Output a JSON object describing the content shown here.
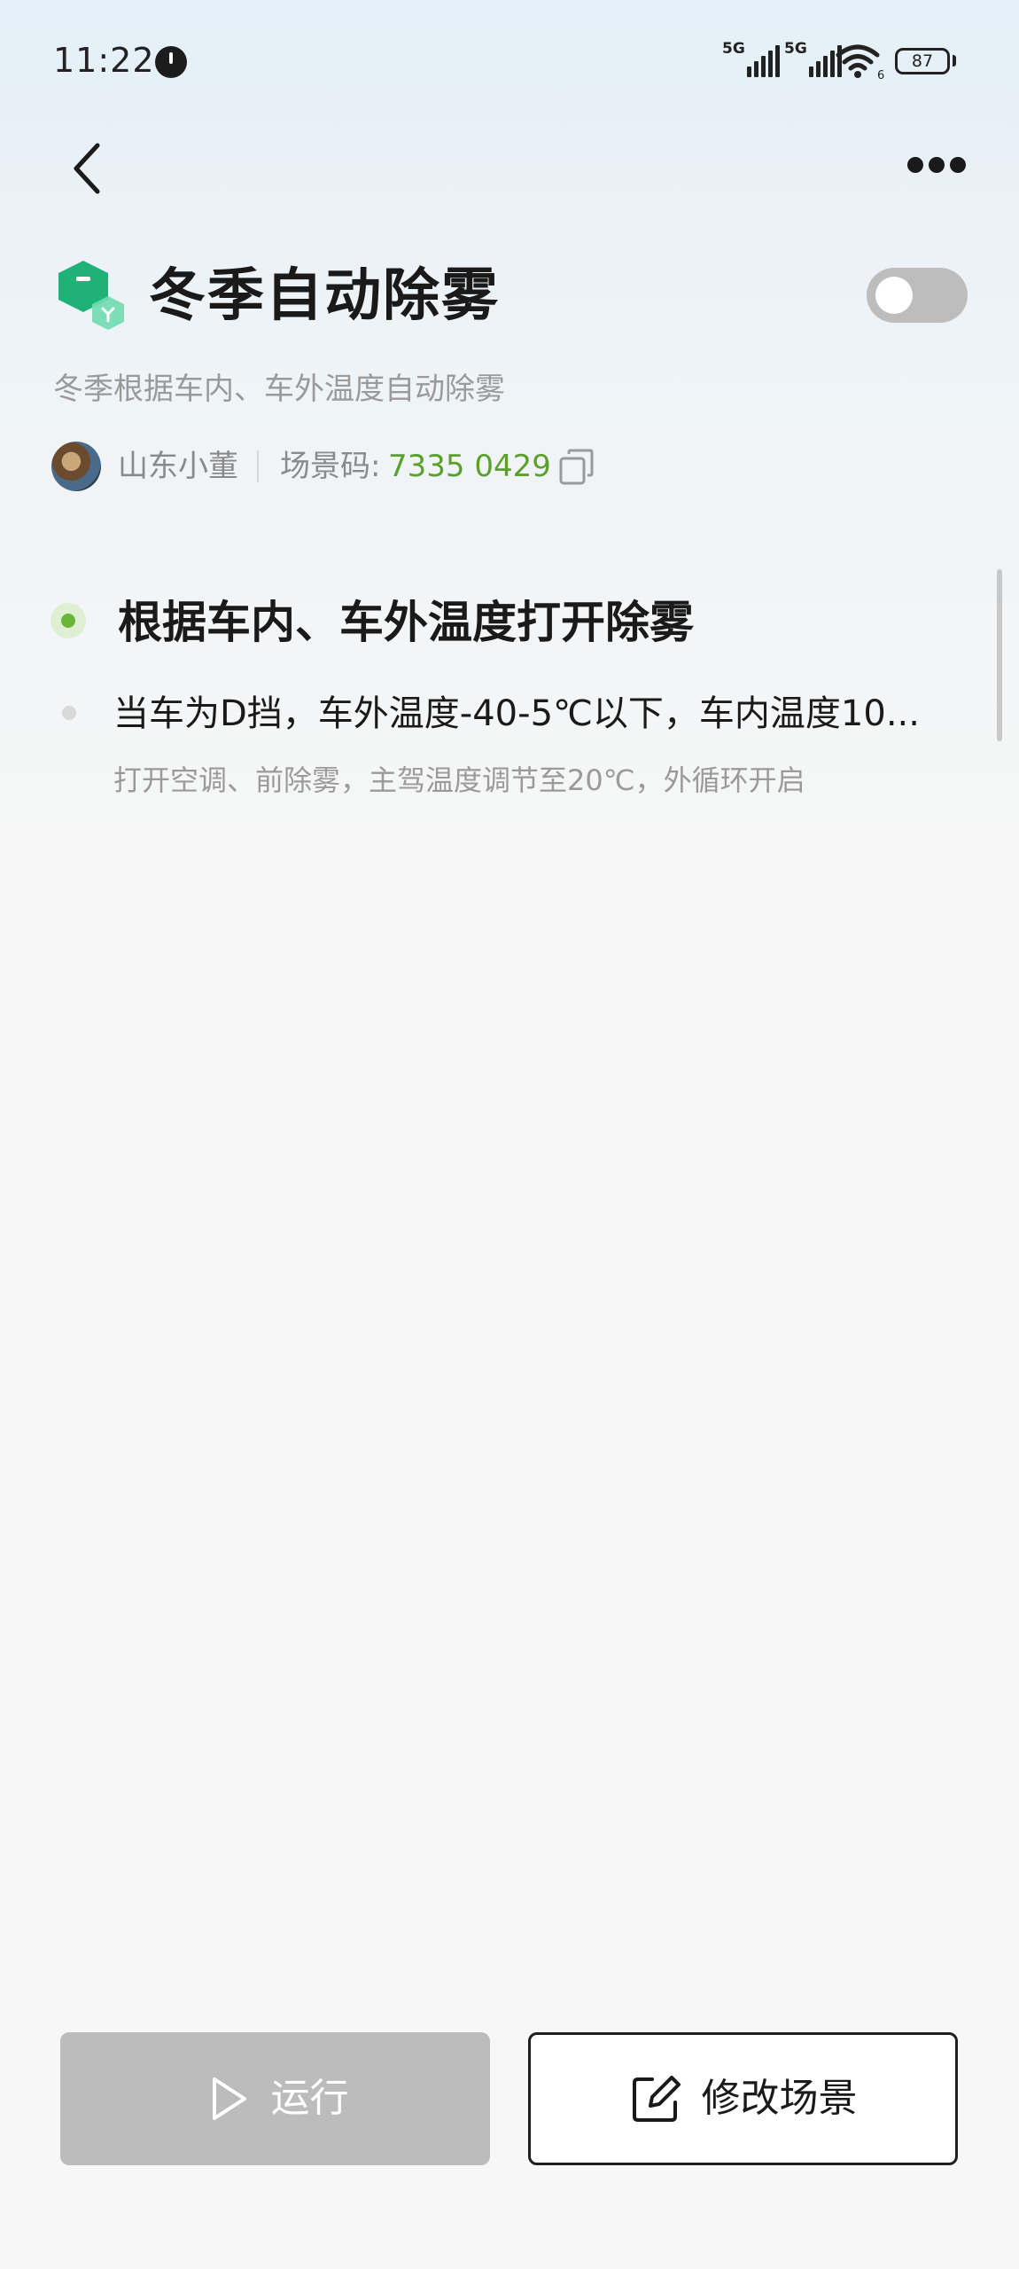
{
  "status_bar": {
    "time": "11:22",
    "signal1_label": "5G",
    "signal2_label": "5G",
    "wifi_badge": "6",
    "battery": "87"
  },
  "header": {
    "back_icon": "chevron-left-icon",
    "more_icon": "more-horizontal-icon"
  },
  "scene": {
    "icon": "smart-scene-cube-icon",
    "title": "冬季自动除雾",
    "enabled": false,
    "description": "冬季根据车内、车外温度自动除雾",
    "author": "山东小董",
    "code_label": "场景码:",
    "code_value": "7335 0429",
    "copy_icon": "copy-icon"
  },
  "condition": {
    "title": "根据车内、车外温度打开除雾",
    "rules": [
      {
        "trigger": "当车为D挡，车外温度-40-5℃以下，车内温度10...",
        "action": "打开空调、前除雾，主驾温度调节至20℃，外循环开启"
      }
    ]
  },
  "buttons": {
    "run_label": "运行",
    "run_icon": "play-icon",
    "edit_label": "修改场景",
    "edit_icon": "edit-icon"
  },
  "colors": {
    "accent_green": "#5aa02c",
    "disabled_gray": "#bcbcbc"
  }
}
